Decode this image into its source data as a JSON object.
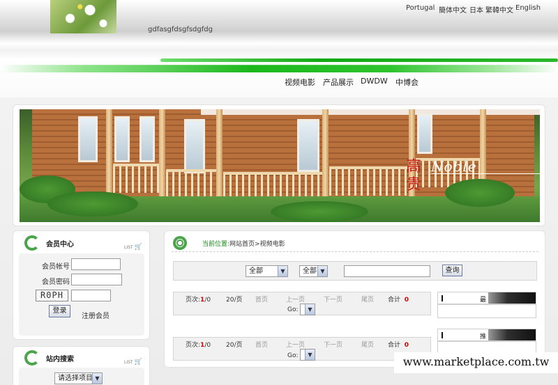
{
  "header": {
    "site_title": "gdfasgfdsgfsdgfdg",
    "languages": [
      "Portugal",
      "簡体中文",
      "日本",
      "繁韓中文",
      "English"
    ],
    "nav": [
      "视频电影",
      "产品展示",
      "DWDW",
      "中博会"
    ]
  },
  "banner": {
    "text_cn": "高 贵",
    "text_en": "Noble"
  },
  "member": {
    "title": "会员中心",
    "list_tag": "LIST",
    "account_label": "会员帐号",
    "password_label": "会员密码",
    "captcha": "R0PH",
    "login_button": "登录",
    "register_link": "注册会员"
  },
  "search_panel": {
    "title": "站内搜索",
    "list_tag": "LIST",
    "select_placeholder": "请选择项目"
  },
  "main": {
    "breadcrumb_prefix": "当前位置:",
    "breadcrumb_path": "网站首页>视频电影",
    "filter1": "全部",
    "filter2": "全部",
    "query_button": "查询",
    "pager": {
      "page_label": "页次:",
      "page_current": "1",
      "page_total": "/0",
      "per_page": "20/页",
      "first": "首页",
      "prev": "上一页",
      "next": "下一页",
      "last": "尾页",
      "total_label": "合计",
      "total_value": "0",
      "go_label": "Go:"
    },
    "side_box1_title": "最",
    "side_box2_title": "推"
  },
  "watermark": "www.marketplace.com.tw"
}
